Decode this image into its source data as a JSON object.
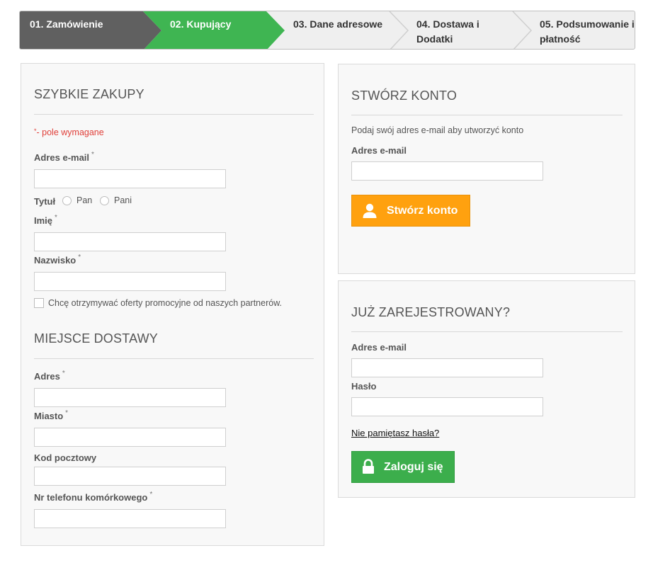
{
  "steps": [
    {
      "label": "01. Zamówienie",
      "state": "done"
    },
    {
      "label": "02. Kupujący",
      "state": "active"
    },
    {
      "label": "03. Dane adresowe",
      "state": "pending"
    },
    {
      "label": "04. Dostawa i Dodatki",
      "state": "pending"
    },
    {
      "label": "05. Podsumowanie i płatność",
      "state": "pending"
    }
  ],
  "colors": {
    "done": "#606060",
    "active": "#3fb552",
    "pending": "#efefef",
    "orange": "#ffa10f",
    "green": "#3cae4c",
    "required": "#e0403a"
  },
  "quick": {
    "heading": "SZYBKIE ZAKUPY",
    "required_star": "*",
    "required_note": "- pole wymagane",
    "email_label": "Adres e-mail",
    "email_value": "",
    "title_label": "Tytuł",
    "title_options": [
      "Pan",
      "Pani"
    ],
    "first_name_label": "Imię",
    "first_name_value": "",
    "last_name_label": "Nazwisko",
    "last_name_value": "",
    "newsletter_label": "Chcę otrzymywać oferty promocyjne od naszych partnerów."
  },
  "delivery": {
    "heading": "MIEJSCE DOSTAWY",
    "address_label": "Adres",
    "address_value": "",
    "city_label": "Miasto",
    "city_value": "",
    "postcode_label": "Kod pocztowy",
    "postcode_value": "",
    "phone_label": "Nr telefonu komórkowego",
    "phone_value": ""
  },
  "create_account": {
    "heading": "STWÓRZ KONTO",
    "hint": "Podaj swój adres e-mail aby utworzyć konto",
    "email_label": "Adres e-mail",
    "email_value": "",
    "button_label": "Stwórz konto",
    "button_icon": "user-icon"
  },
  "login": {
    "heading": "JUŻ ZAREJESTROWANY?",
    "email_label": "Adres e-mail",
    "email_value": "",
    "password_label": "Hasło",
    "password_value": "",
    "forgot_link": "Nie pamiętasz hasła?",
    "button_label": "Zaloguj się",
    "button_icon": "lock-icon"
  }
}
